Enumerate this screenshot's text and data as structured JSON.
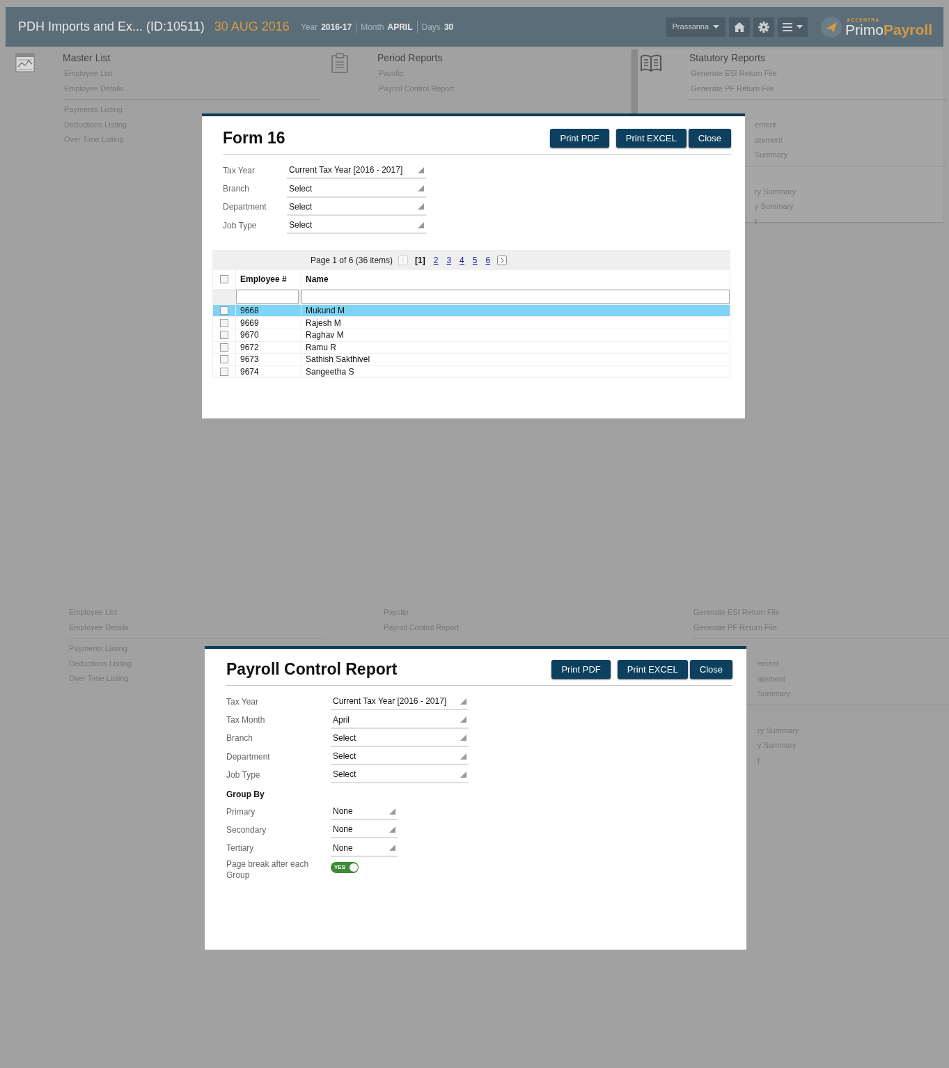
{
  "header": {
    "title": "PDH Imports and Ex... (ID:10511)",
    "date": "30 AUG 2016",
    "stats": [
      {
        "label": "Year",
        "value": "2016-17"
      },
      {
        "label": "Month",
        "value": "APRIL"
      },
      {
        "label": "Days",
        "value": "30"
      }
    ],
    "user": "Prassanna",
    "logo": {
      "tagline": "ACCENTRA",
      "name_first": "Primo",
      "name_second": "Payroll"
    }
  },
  "views": [
    {
      "menu": {
        "columns": [
          {
            "title": "Master List",
            "groups": [
              [
                {
                  "label": "Employee List",
                  "kind": "item"
                },
                {
                  "label": "Employee Details",
                  "kind": "item"
                }
              ],
              [
                {
                  "label": "Payments Listing",
                  "kind": "item"
                },
                {
                  "label": "Deductions Listing",
                  "kind": "item"
                },
                {
                  "label": "Over Time Listing",
                  "kind": "item"
                }
              ]
            ]
          },
          {
            "title": "Period Reports",
            "groups": [
              [
                {
                  "label": "Payslip",
                  "kind": "item"
                },
                {
                  "label": "Payroll Control Report",
                  "kind": "item"
                }
              ]
            ]
          },
          {
            "title": "Statutory Reports",
            "groups": [
              [
                {
                  "label": "Generate ESI Return File",
                  "kind": "item"
                },
                {
                  "label": "Generate PF Return File",
                  "kind": "item"
                }
              ],
              [
                {
                  "label": "ement",
                  "kind": "cut"
                },
                {
                  "label": "atement",
                  "kind": "cut"
                },
                {
                  "label": "Summary",
                  "kind": "cut"
                }
              ],
              [
                {
                  "label": "ry Summary",
                  "kind": "cut"
                },
                {
                  "label": "y Summary",
                  "kind": "cut"
                },
                {
                  "label": "t",
                  "kind": "cut"
                }
              ]
            ]
          }
        ]
      },
      "modal": {
        "title": "Form 16",
        "buttons": [
          "Print PDF",
          "Print EXCEL",
          "Close"
        ],
        "fields": [
          {
            "kind": "select",
            "label": "Tax Year",
            "value": "Current Tax Year [2016 - 2017]"
          },
          {
            "kind": "select",
            "label": "Branch",
            "value": "Select"
          },
          {
            "kind": "select",
            "label": "Department",
            "value": "Select"
          },
          {
            "kind": "select",
            "label": "Job Type",
            "value": "Select"
          }
        ],
        "grid": {
          "pager": {
            "summary": "Page 1 of 6 (36 items)",
            "pages": [
              {
                "label": "[1]",
                "selected": true
              },
              {
                "label": "2",
                "selected": false
              },
              {
                "label": "3",
                "selected": false
              },
              {
                "label": "4",
                "selected": false
              },
              {
                "label": "5",
                "selected": false
              },
              {
                "label": "6",
                "selected": false
              }
            ]
          },
          "columns": [
            "Employee #",
            "Name"
          ],
          "select_all": {
            "checked": false
          },
          "rows": [
            {
              "employee": "9668",
              "name": "Mukund M",
              "selected": true,
              "checked": false
            },
            {
              "employee": "9669",
              "name": "Rajesh M",
              "selected": false,
              "checked": false
            },
            {
              "employee": "9670",
              "name": "Raghav M",
              "selected": false,
              "checked": false
            },
            {
              "employee": "9672",
              "name": "Ramu R",
              "selected": false,
              "checked": false
            },
            {
              "employee": "9673",
              "name": "Sathish Sakthivel",
              "selected": false,
              "checked": false
            },
            {
              "employee": "9674",
              "name": "Sangeetha S",
              "selected": false,
              "checked": false
            }
          ]
        }
      }
    },
    {
      "menu": {
        "columns": [
          {
            "groups": [
              [
                {
                  "label": "Employee List",
                  "kind": "item"
                },
                {
                  "label": "Employee Details",
                  "kind": "item"
                }
              ],
              [
                {
                  "label": "Payments Listing",
                  "kind": "item"
                },
                {
                  "label": "Deductions Listing",
                  "kind": "item"
                },
                {
                  "label": "Over Time Listing",
                  "kind": "item"
                }
              ]
            ]
          },
          {
            "groups": [
              [
                {
                  "label": "Payslip",
                  "kind": "item"
                },
                {
                  "label": "Payroll Control Report",
                  "kind": "item"
                }
              ]
            ]
          },
          {
            "groups": [
              [
                {
                  "label": "Generate ESI Return File",
                  "kind": "item"
                },
                {
                  "label": "Generate PF Return File",
                  "kind": "item"
                }
              ],
              [
                {
                  "label": "ement",
                  "kind": "cut"
                },
                {
                  "label": "atement",
                  "kind": "cut"
                },
                {
                  "label": "Summary",
                  "kind": "cut"
                }
              ],
              [
                {
                  "label": "ry Summary",
                  "kind": "cut"
                },
                {
                  "label": "y Summary",
                  "kind": "cut"
                },
                {
                  "label": "t",
                  "kind": "cut"
                }
              ]
            ]
          }
        ]
      },
      "modal": {
        "title": "Payroll Control Report",
        "buttons": [
          "Print PDF",
          "Print EXCEL",
          "Close"
        ],
        "fields": [
          {
            "kind": "select",
            "label": "Tax Year",
            "value": "Current Tax Year [2016 - 2017]"
          },
          {
            "kind": "select",
            "label": "Tax Month",
            "value": "April"
          },
          {
            "kind": "select",
            "label": "Branch",
            "value": "Select"
          },
          {
            "kind": "select",
            "label": "Department",
            "value": "Select"
          },
          {
            "kind": "select",
            "label": "Job Type",
            "value": "Select"
          },
          {
            "kind": "heading",
            "label": "Group By"
          },
          {
            "kind": "short_select",
            "label": "Primary",
            "value": "None"
          },
          {
            "kind": "short_select",
            "label": "Secondary",
            "value": "None"
          },
          {
            "kind": "short_select",
            "label": "Tertiary",
            "value": "None"
          },
          {
            "kind": "toggle",
            "label": "Page break after each Group",
            "text": "YES",
            "on": true
          }
        ]
      }
    }
  ]
}
